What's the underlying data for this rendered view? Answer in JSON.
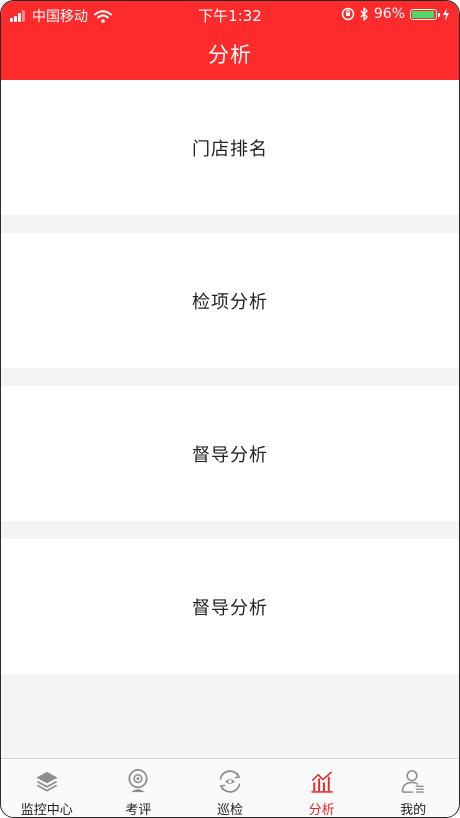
{
  "status_bar": {
    "carrier": "中国移动",
    "time": "下午1:32",
    "battery": "96%",
    "battery_level": 0.96,
    "battery_color": "#4cd964"
  },
  "header": {
    "title": "分析",
    "background_color": "#fd2b2b"
  },
  "menu": {
    "items": [
      {
        "label": "门店排名"
      },
      {
        "label": "检项分析"
      },
      {
        "label": "督导分析"
      },
      {
        "label": "督导分析"
      }
    ]
  },
  "tabbar": {
    "active_color": "#e8262b",
    "inactive_icon_color": "#8e8e8e",
    "items": [
      {
        "label": "监控中心",
        "icon": "layers-icon",
        "active": false
      },
      {
        "label": "考评",
        "icon": "camera-icon",
        "active": false
      },
      {
        "label": "巡检",
        "icon": "inspection-icon",
        "active": false
      },
      {
        "label": "分析",
        "icon": "chart-icon",
        "active": true
      },
      {
        "label": "我的",
        "icon": "user-icon",
        "active": false
      }
    ]
  }
}
